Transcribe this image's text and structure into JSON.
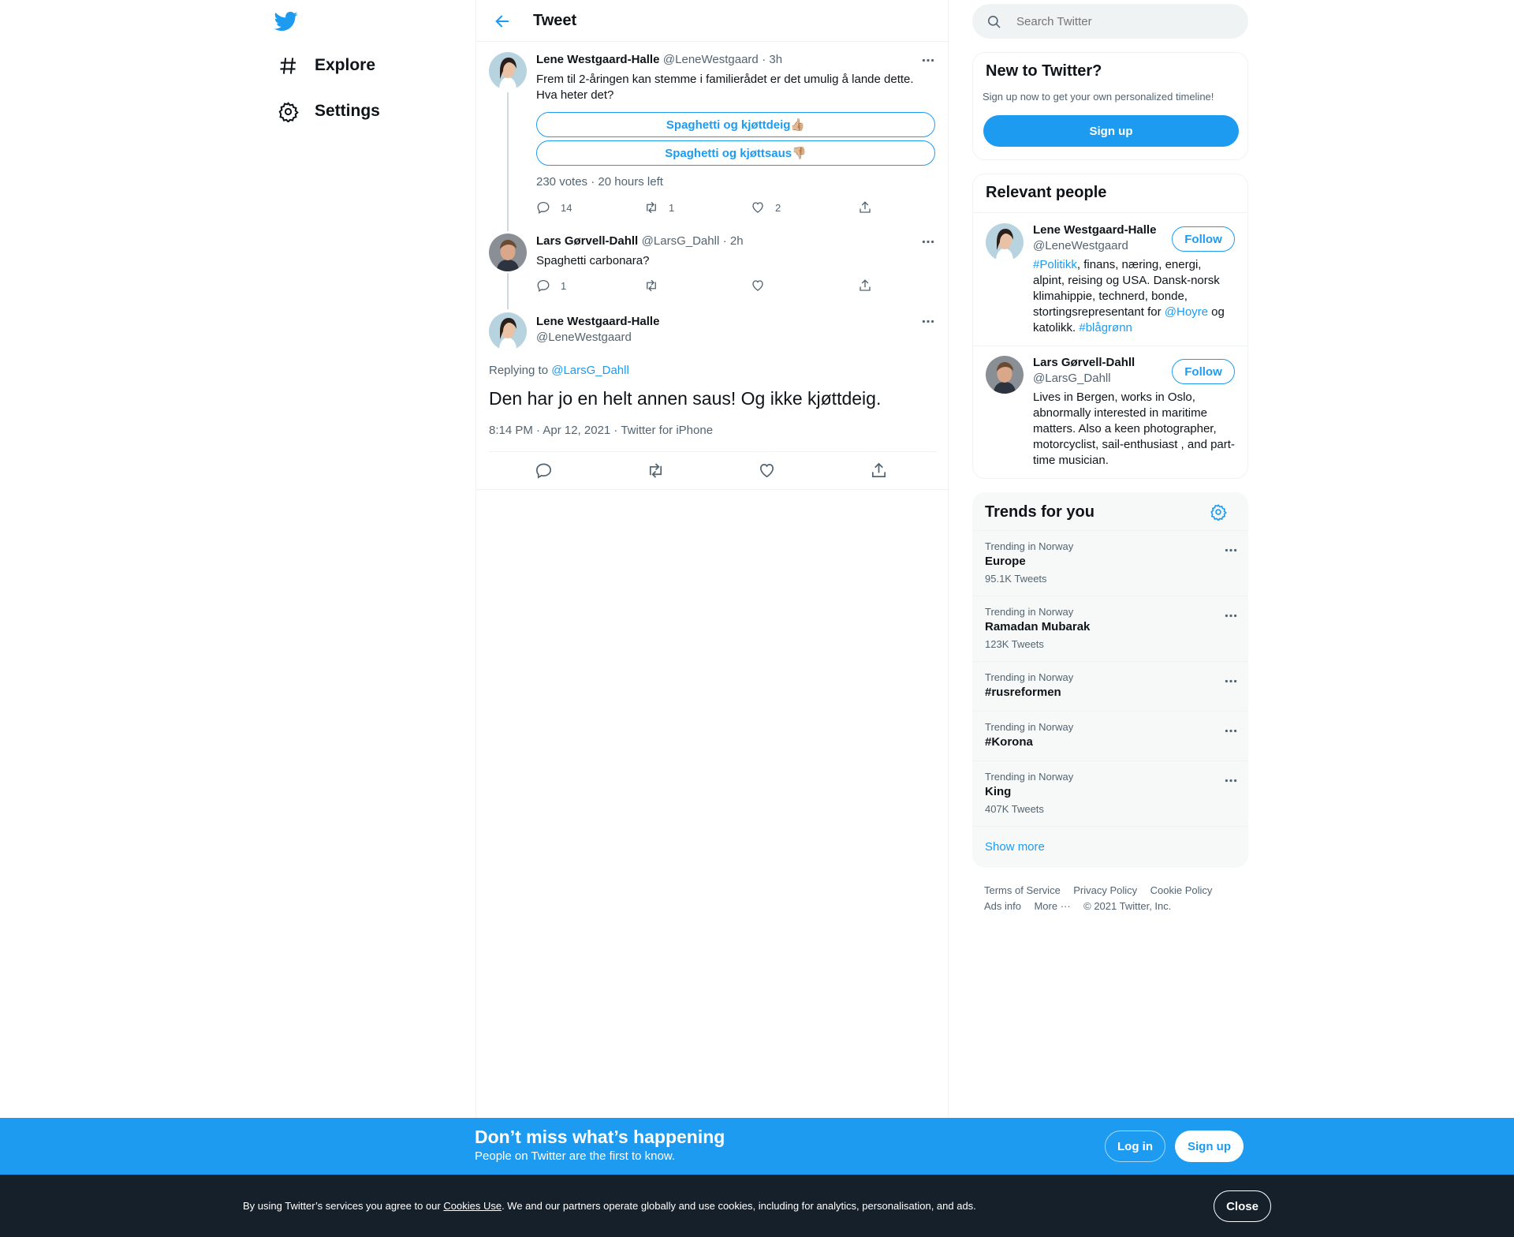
{
  "nav": {
    "explore": "Explore",
    "settings": "Settings"
  },
  "header": {
    "title": "Tweet"
  },
  "thread": [
    {
      "name": "Lene Westgaard-Halle",
      "handle": "@LeneWestgaard",
      "time": "· 3h",
      "text_line1": "Frem til 2-åringen kan stemme i familierådet er det umulig å lande dette.",
      "text_line2": "Hva heter det?",
      "poll": {
        "options": [
          "Spaghetti og kjøttdeig👍🏼",
          "Spaghetti og kjøttsaus👎🏼"
        ],
        "summary": "230 votes · 20 hours left"
      },
      "replies": "14",
      "retweets": "1",
      "likes": "2"
    },
    {
      "name": "Lars Gørvell-Dahll",
      "handle": "@LarsG_Dahll",
      "time": "· 2h",
      "text": "Spaghetti carbonara?",
      "replies": "1",
      "retweets": "",
      "likes": ""
    }
  ],
  "main_tweet": {
    "name": "Lene Westgaard-Halle",
    "handle": "@LeneWestgaard",
    "replying_prefix": "Replying to",
    "replying_to": "@LarsG_Dahll",
    "text": "Den har jo en helt annen saus! Og ikke kjøttdeig.",
    "meta": "8:14 PM · Apr 12, 2021 · Twitter for iPhone"
  },
  "search": {
    "placeholder": "Search Twitter"
  },
  "new_to_twitter": {
    "title": "New to Twitter?",
    "subtitle": "Sign up now to get your own personalized timeline!",
    "button": "Sign up"
  },
  "relevant_people": {
    "title": "Relevant people",
    "follow_label": "Follow",
    "people": [
      {
        "name": "Lene Westgaard-Halle",
        "handle": "@LeneWestgaard",
        "bio_tag1": "#Politikk",
        "bio_part1": ", finans, næring, energi,",
        "bio_line2": "alpint, reising og USA. Dansk-norsk",
        "bio_line3": "klimahippie, technerd, bonde,",
        "bio_line4a": "stortingsrepresentant for ",
        "bio_mention": "@Hoyre",
        "bio_line4b": " og",
        "bio_line5a": "katolikk. ",
        "bio_tag2": "#blågrønn"
      },
      {
        "name": "Lars Gørvell-Dahll",
        "handle": "@LarsG_Dahll",
        "bio_line1": "Lives in Bergen, works in Oslo,",
        "bio_line2": "abnormally interested in maritime",
        "bio_line3": "matters. Also a keen photographer,",
        "bio_line4": "motorcyclist, sail-enthusiast , and part-",
        "bio_line5": "time musician."
      }
    ]
  },
  "trends": {
    "title": "Trends for you",
    "items": [
      {
        "context": "Trending in Norway",
        "name": "Europe",
        "count": "95.1K Tweets"
      },
      {
        "context": "Trending in Norway",
        "name": "Ramadan Mubarak",
        "count": "123K Tweets"
      },
      {
        "context": "Trending in Norway",
        "name": "#rusreformen",
        "count": ""
      },
      {
        "context": "Trending in Norway",
        "name": "#Korona",
        "count": ""
      },
      {
        "context": "Trending in Norway",
        "name": "King",
        "count": "407K Tweets"
      }
    ],
    "show_more": "Show more"
  },
  "footer": {
    "terms": "Terms of Service",
    "privacy": "Privacy Policy",
    "cookie": "Cookie Policy",
    "ads": "Ads info",
    "more": "More",
    "copyright": "© 2021 Twitter, Inc."
  },
  "signup_bar": {
    "title": "Don’t miss what’s happening",
    "subtitle": "People on Twitter are the first to know.",
    "login": "Log in",
    "signup": "Sign up"
  },
  "cookie_bar": {
    "text_before": "By using Twitter’s services you agree to our ",
    "link": "Cookies Use",
    "text_after": ". We and our partners operate globally and use cookies, including for analytics, personalisation, and ads.",
    "close": "Close"
  },
  "colors": {
    "accent": "#1d9bf0",
    "text": "#0f1419",
    "secondary": "#536471",
    "cookie_bg": "#15202b"
  }
}
